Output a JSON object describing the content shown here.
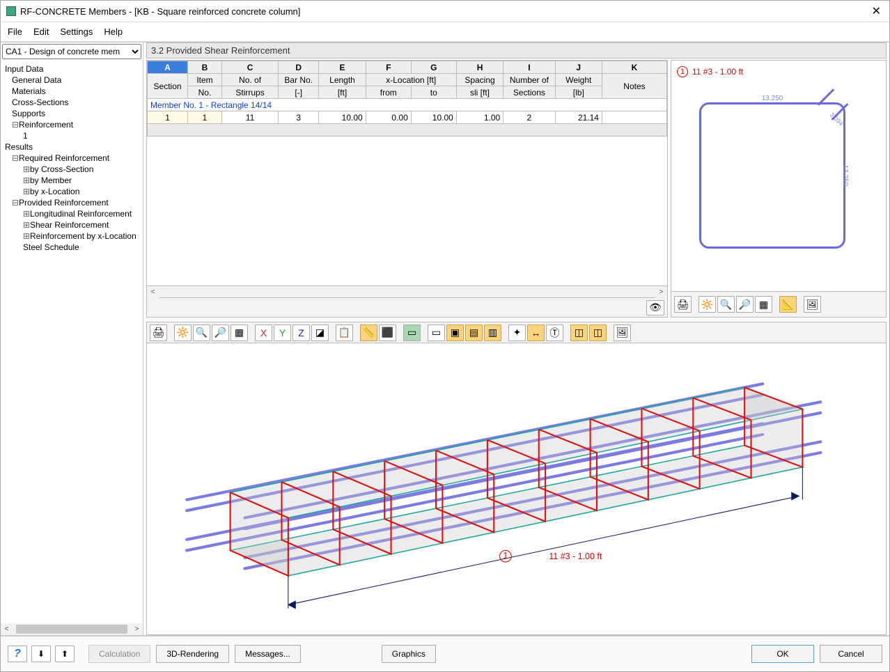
{
  "window": {
    "title": "RF-CONCRETE Members - [KB - Square reinforced concrete column]"
  },
  "menu": {
    "file": "File",
    "edit": "Edit",
    "settings": "Settings",
    "help": "Help"
  },
  "caseSelector": "CA1 - Design of concrete mem",
  "tree": {
    "inputData": "Input Data",
    "generalData": "General Data",
    "materials": "Materials",
    "crossSections": "Cross-Sections",
    "supports": "Supports",
    "reinforcement": "Reinforcement",
    "reinforcement1": "1",
    "results": "Results",
    "required": "Required Reinforcement",
    "byCross": "by Cross-Section",
    "byMember": "by Member",
    "byX": "by x-Location",
    "provided": "Provided Reinforcement",
    "longReinf": "Longitudinal Reinforcement",
    "shearReinf": "Shear Reinforcement",
    "reinfByX": "Reinforcement by x-Location",
    "steelSchedule": "Steel Schedule"
  },
  "pane": {
    "title": "3.2  Provided Shear Reinforcement"
  },
  "table": {
    "cols": [
      "A",
      "B",
      "C",
      "D",
      "E",
      "F",
      "G",
      "H",
      "I",
      "J",
      "K"
    ],
    "h1": [
      "Section",
      "Item",
      "No. of",
      "Bar No.",
      "Length",
      "x-Location [ft]",
      "Spacing",
      "Number of",
      "Weight",
      ""
    ],
    "h2": [
      "",
      "No.",
      "Stirrups",
      "[-]",
      "[ft]",
      "from",
      "to",
      "sli [ft]",
      "Sections",
      "[lb]",
      "Notes"
    ],
    "memberHeader": "Member No. 1  -  Rectangle 14/14",
    "row": [
      "1",
      "1",
      "11",
      "3",
      "10.00",
      "0.00",
      "10.00",
      "1.00",
      "2",
      "21.14",
      ""
    ]
  },
  "section": {
    "indicator": "1",
    "label": "11 #3 - 1.00 ft",
    "dimTop": "13.250",
    "dimRight": "13.250",
    "dimFold": "3.094"
  },
  "beamLabel": {
    "indicator": "1",
    "text": "11 #3 - 1.00 ft"
  },
  "footer": {
    "calculation": "Calculation",
    "rendering": "3D-Rendering",
    "messages": "Messages...",
    "graphics": "Graphics",
    "ok": "OK",
    "cancel": "Cancel"
  }
}
